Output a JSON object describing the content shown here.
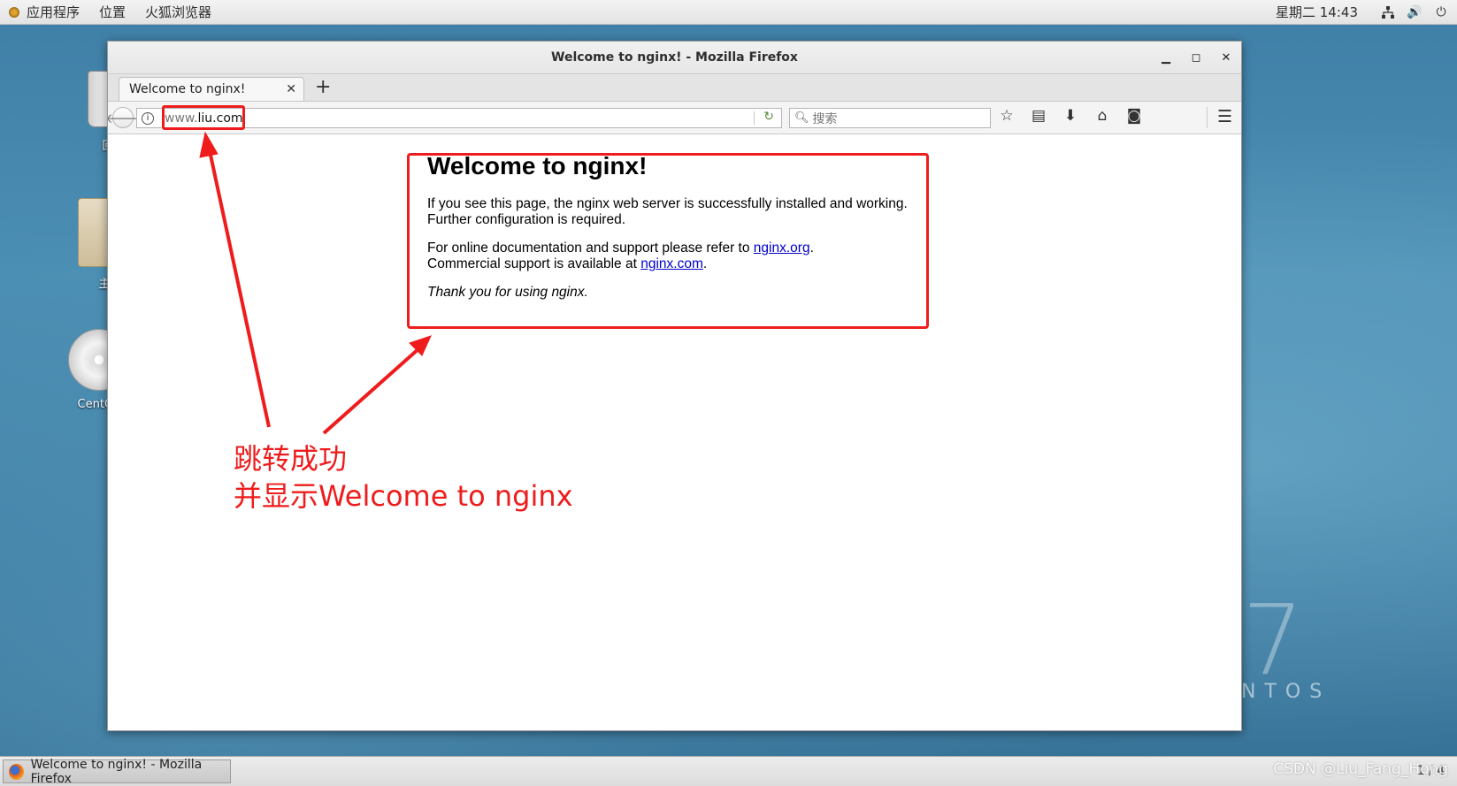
{
  "top_panel": {
    "menus": [
      "应用程序",
      "位置",
      "火狐浏览器"
    ],
    "clock": "星期二 14:43",
    "tray_icons": [
      "network-icon",
      "volume-icon",
      "power-icon"
    ]
  },
  "desktop": {
    "icons": [
      {
        "name": "trash",
        "label": "回"
      },
      {
        "name": "home-folder",
        "label": "主"
      },
      {
        "name": "disc",
        "label": "CentOS"
      }
    ],
    "brand": "NTOS",
    "brand_numeral": "7"
  },
  "window": {
    "title": "Welcome to nginx! - Mozilla Firefox",
    "controls": [
      "minimize",
      "maximize",
      "close"
    ],
    "tab": {
      "label": "Welcome to nginx!"
    },
    "url": {
      "prefix": "www.",
      "domain": "liu.com"
    },
    "search_placeholder": "搜索"
  },
  "page": {
    "heading": "Welcome to nginx!",
    "para1": "If you see this page, the nginx web server is successfully installed and working. Further configuration is required.",
    "para2_a": "For online documentation and support please refer to ",
    "link1": "nginx.org",
    "para2_b": ".",
    "para3_a": "Commercial support is available at ",
    "link2": "nginx.com",
    "para3_b": ".",
    "thanks": "Thank you for using nginx."
  },
  "annotation": {
    "line1": "跳转成功",
    "line2": "并显示Welcome to nginx",
    "color": "#ee1c1c"
  },
  "taskbar": {
    "item": "Welcome to nginx! - Mozilla Firefox",
    "watermark": "CSDN @Liu_Fang_Hong",
    "page_indicator": "1 / 4"
  }
}
